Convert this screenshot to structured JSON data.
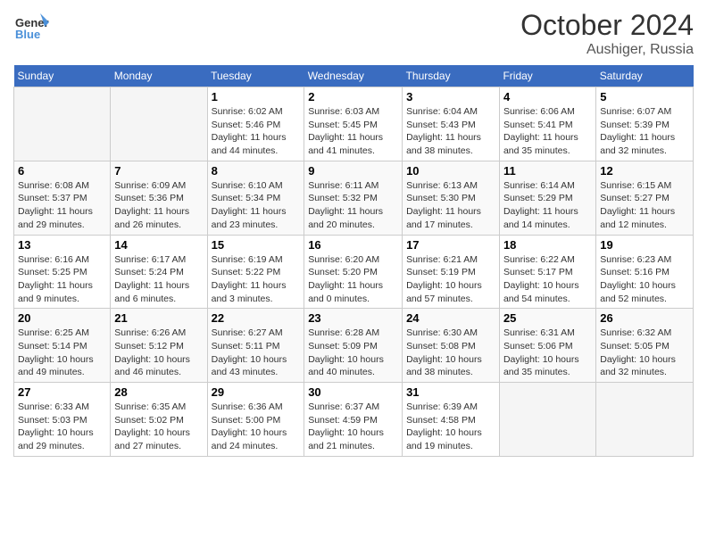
{
  "header": {
    "logo_general": "General",
    "logo_blue": "Blue",
    "month": "October 2024",
    "location": "Aushiger, Russia"
  },
  "weekdays": [
    "Sunday",
    "Monday",
    "Tuesday",
    "Wednesday",
    "Thursday",
    "Friday",
    "Saturday"
  ],
  "weeks": [
    [
      {
        "day": "",
        "sunrise": "",
        "sunset": "",
        "daylight": "",
        "empty": true
      },
      {
        "day": "",
        "sunrise": "",
        "sunset": "",
        "daylight": "",
        "empty": true
      },
      {
        "day": "1",
        "sunrise": "Sunrise: 6:02 AM",
        "sunset": "Sunset: 5:46 PM",
        "daylight": "Daylight: 11 hours and 44 minutes."
      },
      {
        "day": "2",
        "sunrise": "Sunrise: 6:03 AM",
        "sunset": "Sunset: 5:45 PM",
        "daylight": "Daylight: 11 hours and 41 minutes."
      },
      {
        "day": "3",
        "sunrise": "Sunrise: 6:04 AM",
        "sunset": "Sunset: 5:43 PM",
        "daylight": "Daylight: 11 hours and 38 minutes."
      },
      {
        "day": "4",
        "sunrise": "Sunrise: 6:06 AM",
        "sunset": "Sunset: 5:41 PM",
        "daylight": "Daylight: 11 hours and 35 minutes."
      },
      {
        "day": "5",
        "sunrise": "Sunrise: 6:07 AM",
        "sunset": "Sunset: 5:39 PM",
        "daylight": "Daylight: 11 hours and 32 minutes."
      }
    ],
    [
      {
        "day": "6",
        "sunrise": "Sunrise: 6:08 AM",
        "sunset": "Sunset: 5:37 PM",
        "daylight": "Daylight: 11 hours and 29 minutes."
      },
      {
        "day": "7",
        "sunrise": "Sunrise: 6:09 AM",
        "sunset": "Sunset: 5:36 PM",
        "daylight": "Daylight: 11 hours and 26 minutes."
      },
      {
        "day": "8",
        "sunrise": "Sunrise: 6:10 AM",
        "sunset": "Sunset: 5:34 PM",
        "daylight": "Daylight: 11 hours and 23 minutes."
      },
      {
        "day": "9",
        "sunrise": "Sunrise: 6:11 AM",
        "sunset": "Sunset: 5:32 PM",
        "daylight": "Daylight: 11 hours and 20 minutes."
      },
      {
        "day": "10",
        "sunrise": "Sunrise: 6:13 AM",
        "sunset": "Sunset: 5:30 PM",
        "daylight": "Daylight: 11 hours and 17 minutes."
      },
      {
        "day": "11",
        "sunrise": "Sunrise: 6:14 AM",
        "sunset": "Sunset: 5:29 PM",
        "daylight": "Daylight: 11 hours and 14 minutes."
      },
      {
        "day": "12",
        "sunrise": "Sunrise: 6:15 AM",
        "sunset": "Sunset: 5:27 PM",
        "daylight": "Daylight: 11 hours and 12 minutes."
      }
    ],
    [
      {
        "day": "13",
        "sunrise": "Sunrise: 6:16 AM",
        "sunset": "Sunset: 5:25 PM",
        "daylight": "Daylight: 11 hours and 9 minutes."
      },
      {
        "day": "14",
        "sunrise": "Sunrise: 6:17 AM",
        "sunset": "Sunset: 5:24 PM",
        "daylight": "Daylight: 11 hours and 6 minutes."
      },
      {
        "day": "15",
        "sunrise": "Sunrise: 6:19 AM",
        "sunset": "Sunset: 5:22 PM",
        "daylight": "Daylight: 11 hours and 3 minutes."
      },
      {
        "day": "16",
        "sunrise": "Sunrise: 6:20 AM",
        "sunset": "Sunset: 5:20 PM",
        "daylight": "Daylight: 11 hours and 0 minutes."
      },
      {
        "day": "17",
        "sunrise": "Sunrise: 6:21 AM",
        "sunset": "Sunset: 5:19 PM",
        "daylight": "Daylight: 10 hours and 57 minutes."
      },
      {
        "day": "18",
        "sunrise": "Sunrise: 6:22 AM",
        "sunset": "Sunset: 5:17 PM",
        "daylight": "Daylight: 10 hours and 54 minutes."
      },
      {
        "day": "19",
        "sunrise": "Sunrise: 6:23 AM",
        "sunset": "Sunset: 5:16 PM",
        "daylight": "Daylight: 10 hours and 52 minutes."
      }
    ],
    [
      {
        "day": "20",
        "sunrise": "Sunrise: 6:25 AM",
        "sunset": "Sunset: 5:14 PM",
        "daylight": "Daylight: 10 hours and 49 minutes."
      },
      {
        "day": "21",
        "sunrise": "Sunrise: 6:26 AM",
        "sunset": "Sunset: 5:12 PM",
        "daylight": "Daylight: 10 hours and 46 minutes."
      },
      {
        "day": "22",
        "sunrise": "Sunrise: 6:27 AM",
        "sunset": "Sunset: 5:11 PM",
        "daylight": "Daylight: 10 hours and 43 minutes."
      },
      {
        "day": "23",
        "sunrise": "Sunrise: 6:28 AM",
        "sunset": "Sunset: 5:09 PM",
        "daylight": "Daylight: 10 hours and 40 minutes."
      },
      {
        "day": "24",
        "sunrise": "Sunrise: 6:30 AM",
        "sunset": "Sunset: 5:08 PM",
        "daylight": "Daylight: 10 hours and 38 minutes."
      },
      {
        "day": "25",
        "sunrise": "Sunrise: 6:31 AM",
        "sunset": "Sunset: 5:06 PM",
        "daylight": "Daylight: 10 hours and 35 minutes."
      },
      {
        "day": "26",
        "sunrise": "Sunrise: 6:32 AM",
        "sunset": "Sunset: 5:05 PM",
        "daylight": "Daylight: 10 hours and 32 minutes."
      }
    ],
    [
      {
        "day": "27",
        "sunrise": "Sunrise: 6:33 AM",
        "sunset": "Sunset: 5:03 PM",
        "daylight": "Daylight: 10 hours and 29 minutes."
      },
      {
        "day": "28",
        "sunrise": "Sunrise: 6:35 AM",
        "sunset": "Sunset: 5:02 PM",
        "daylight": "Daylight: 10 hours and 27 minutes."
      },
      {
        "day": "29",
        "sunrise": "Sunrise: 6:36 AM",
        "sunset": "Sunset: 5:00 PM",
        "daylight": "Daylight: 10 hours and 24 minutes."
      },
      {
        "day": "30",
        "sunrise": "Sunrise: 6:37 AM",
        "sunset": "Sunset: 4:59 PM",
        "daylight": "Daylight: 10 hours and 21 minutes."
      },
      {
        "day": "31",
        "sunrise": "Sunrise: 6:39 AM",
        "sunset": "Sunset: 4:58 PM",
        "daylight": "Daylight: 10 hours and 19 minutes."
      },
      {
        "day": "",
        "sunrise": "",
        "sunset": "",
        "daylight": "",
        "empty": true
      },
      {
        "day": "",
        "sunrise": "",
        "sunset": "",
        "daylight": "",
        "empty": true
      }
    ]
  ]
}
